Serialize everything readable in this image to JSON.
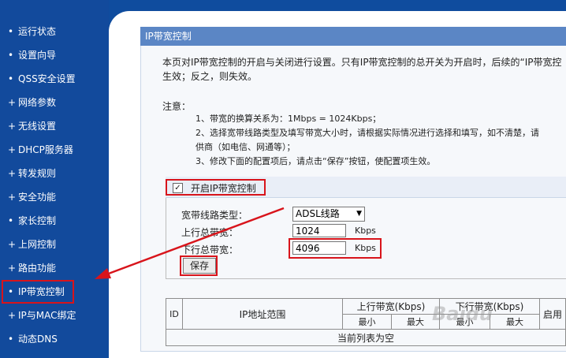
{
  "sidebar": {
    "items": [
      {
        "label": "运行状态",
        "marker": "•"
      },
      {
        "label": "设置向导",
        "marker": "•"
      },
      {
        "label": "QSS安全设置",
        "marker": "•"
      },
      {
        "label": "网络参数",
        "marker": "+"
      },
      {
        "label": "无线设置",
        "marker": "+"
      },
      {
        "label": "DHCP服务器",
        "marker": "+"
      },
      {
        "label": "转发规则",
        "marker": "+"
      },
      {
        "label": "安全功能",
        "marker": "+"
      },
      {
        "label": "家长控制",
        "marker": "•"
      },
      {
        "label": "上网控制",
        "marker": "+"
      },
      {
        "label": "路由功能",
        "marker": "+"
      },
      {
        "label": "IP带宽控制",
        "marker": "•"
      },
      {
        "label": "IP与MAC绑定",
        "marker": "+"
      },
      {
        "label": "动态DNS",
        "marker": "•"
      }
    ]
  },
  "page": {
    "title": "IP带宽控制",
    "intro_line1": "本页对IP带宽控制的开启与关闭进行设置。只有IP带宽控制的总开关为开启时，后续的“IP带宽控",
    "intro_line2": "生效；反之，则失效。",
    "note_label": "注意：",
    "note1": "1、带宽的换算关系为：1Mbps = 1024Kbps；",
    "note2": "2、选择宽带线路类型及填写带宽大小时，请根据实际情况进行选择和填写，如不清楚，请",
    "note2b": "供商（如电信、网通等）；",
    "note3": "3、修改下面的配置项后，请点击“保存”按钮，使配置项生效。"
  },
  "form": {
    "enable_label": "开启IP带宽控制",
    "enable_checked": "✓",
    "line_type_label": "宽带线路类型：",
    "line_type_value": "ADSL线路",
    "up_label": "上行总带宽：",
    "up_value": "1024",
    "down_label": "下行总带宽：",
    "down_value": "4096",
    "unit": "Kbps",
    "save_label": "保存"
  },
  "table": {
    "col_id": "ID",
    "col_range": "IP地址范围",
    "col_up": "上行带宽(Kbps)",
    "col_down": "下行带宽(Kbps)",
    "col_enable": "启用",
    "min": "最小",
    "max": "最大",
    "empty": "当前列表为空"
  },
  "watermark": "Baidu"
}
